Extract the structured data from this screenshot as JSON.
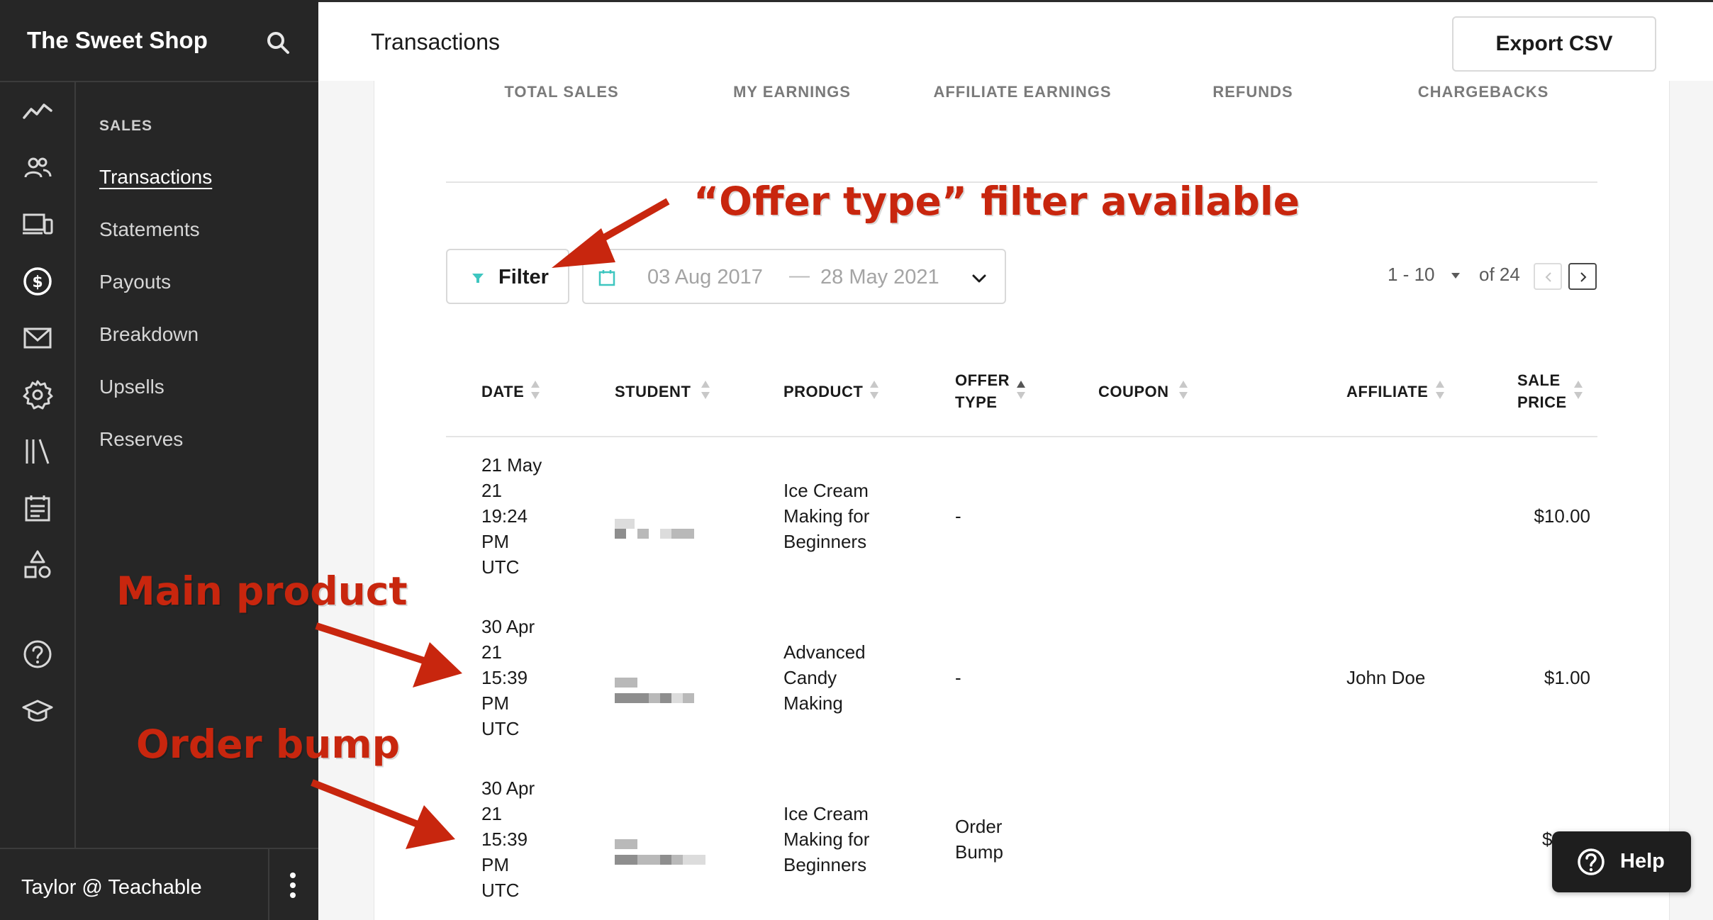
{
  "app": {
    "brand": "The Sweet Shop",
    "account": "Taylor @ Teachable"
  },
  "rail_icons": [
    "analytics-icon",
    "users-icon",
    "devices-icon",
    "dollar-icon",
    "mail-icon",
    "settings-gear-icon",
    "library-icon",
    "calendar-list-icon",
    "shapes-icon",
    "help-circle-icon",
    "graduation-cap-icon"
  ],
  "nav": {
    "section": "SALES",
    "items": [
      {
        "label": "Transactions",
        "active": true
      },
      {
        "label": "Statements",
        "active": false
      },
      {
        "label": "Payouts",
        "active": false
      },
      {
        "label": "Breakdown",
        "active": false
      },
      {
        "label": "Upsells",
        "active": false
      },
      {
        "label": "Reserves",
        "active": false
      }
    ]
  },
  "header": {
    "title": "Transactions",
    "export_label": "Export CSV"
  },
  "stats_tabs": [
    "TOTAL SALES",
    "MY EARNINGS",
    "AFFILIATE EARNINGS",
    "REFUNDS",
    "CHARGEBACKS"
  ],
  "toolbar": {
    "filter_label": "Filter",
    "date_start": "03 Aug 2017",
    "date_separator": "—",
    "date_end": "28 May 2021",
    "page_range": "1 - 10",
    "page_total": "of 24"
  },
  "table": {
    "columns": [
      "DATE",
      "STUDENT",
      "PRODUCT",
      "OFFER\nTYPE",
      "COUPON",
      "AFFILIATE",
      "SALE\nPRICE"
    ],
    "rows": [
      {
        "date": "21 May\n21\n19:24\nPM\nUTC",
        "student": "",
        "product": "Ice Cream\nMaking for\nBeginners",
        "offer_type": "-",
        "coupon": "",
        "affiliate": "",
        "sale_price": "$10.00"
      },
      {
        "date": "30 Apr\n21\n15:39\nPM\nUTC",
        "student": "",
        "product": "Advanced\nCandy\nMaking",
        "offer_type": "-",
        "coupon": "",
        "affiliate": "John Doe",
        "sale_price": "$1.00"
      },
      {
        "date": "30 Apr\n21\n15:39\nPM\nUTC",
        "student": "",
        "product": "Ice Cream\nMaking for\nBeginners",
        "offer_type": "Order\nBump",
        "coupon": "",
        "affiliate": "",
        "sale_price": "$"
      }
    ]
  },
  "annotations": {
    "offer_filter": "“Offer type” filter available",
    "main_product": "Main product",
    "order_bump": "Order bump"
  },
  "help": {
    "label": "Help"
  },
  "colors": {
    "sidebar_bg": "#262626",
    "annotation_red": "#c8260e",
    "accent_teal": "#3ec6c0"
  }
}
